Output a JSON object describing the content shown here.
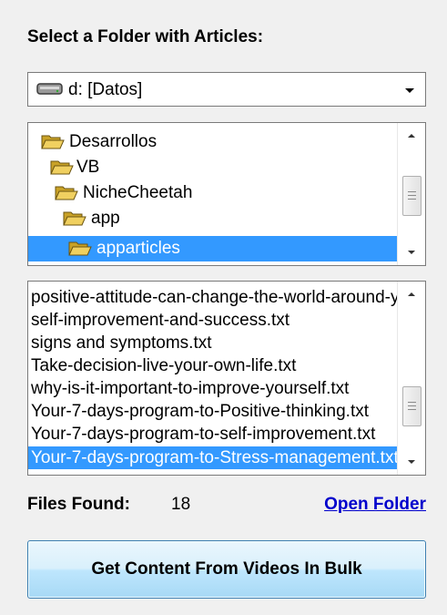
{
  "heading": "Select a Folder with Articles:",
  "drive": {
    "label": "d: [Datos]",
    "icon": "drive-icon"
  },
  "folders": {
    "items": [
      {
        "label": "Desarrollos",
        "depth": 0,
        "selected": false
      },
      {
        "label": "VB",
        "depth": 1,
        "selected": false
      },
      {
        "label": "NicheCheetah",
        "depth": 2,
        "selected": false
      },
      {
        "label": "app",
        "depth": 3,
        "selected": false
      },
      {
        "label": "apparticles",
        "depth": 4,
        "selected": true
      }
    ]
  },
  "files": {
    "items": [
      {
        "label": "positive-attitude-can-change-the-world-around-you.txt",
        "selected": false
      },
      {
        "label": "self-improvement-and-success.txt",
        "selected": false
      },
      {
        "label": "signs and symptoms.txt",
        "selected": false
      },
      {
        "label": "Take-decision-live-your-own-life.txt",
        "selected": false
      },
      {
        "label": "why-is-it-important-to-improve-yourself.txt",
        "selected": false
      },
      {
        "label": "Your-7-days-program-to-Positive-thinking.txt",
        "selected": false
      },
      {
        "label": "Your-7-days-program-to-self-improvement.txt",
        "selected": false
      },
      {
        "label": "Your-7-days-program-to-Stress-management.txt",
        "selected": true
      }
    ]
  },
  "status": {
    "files_found_label": "Files Found:",
    "files_found_count": "18"
  },
  "open_folder_label": "Open Folder",
  "bulk_button_label": "Get Content From Videos In Bulk",
  "colors": {
    "selection": "#3399ff",
    "link": "#0000cc",
    "folder": "#e8c440"
  }
}
